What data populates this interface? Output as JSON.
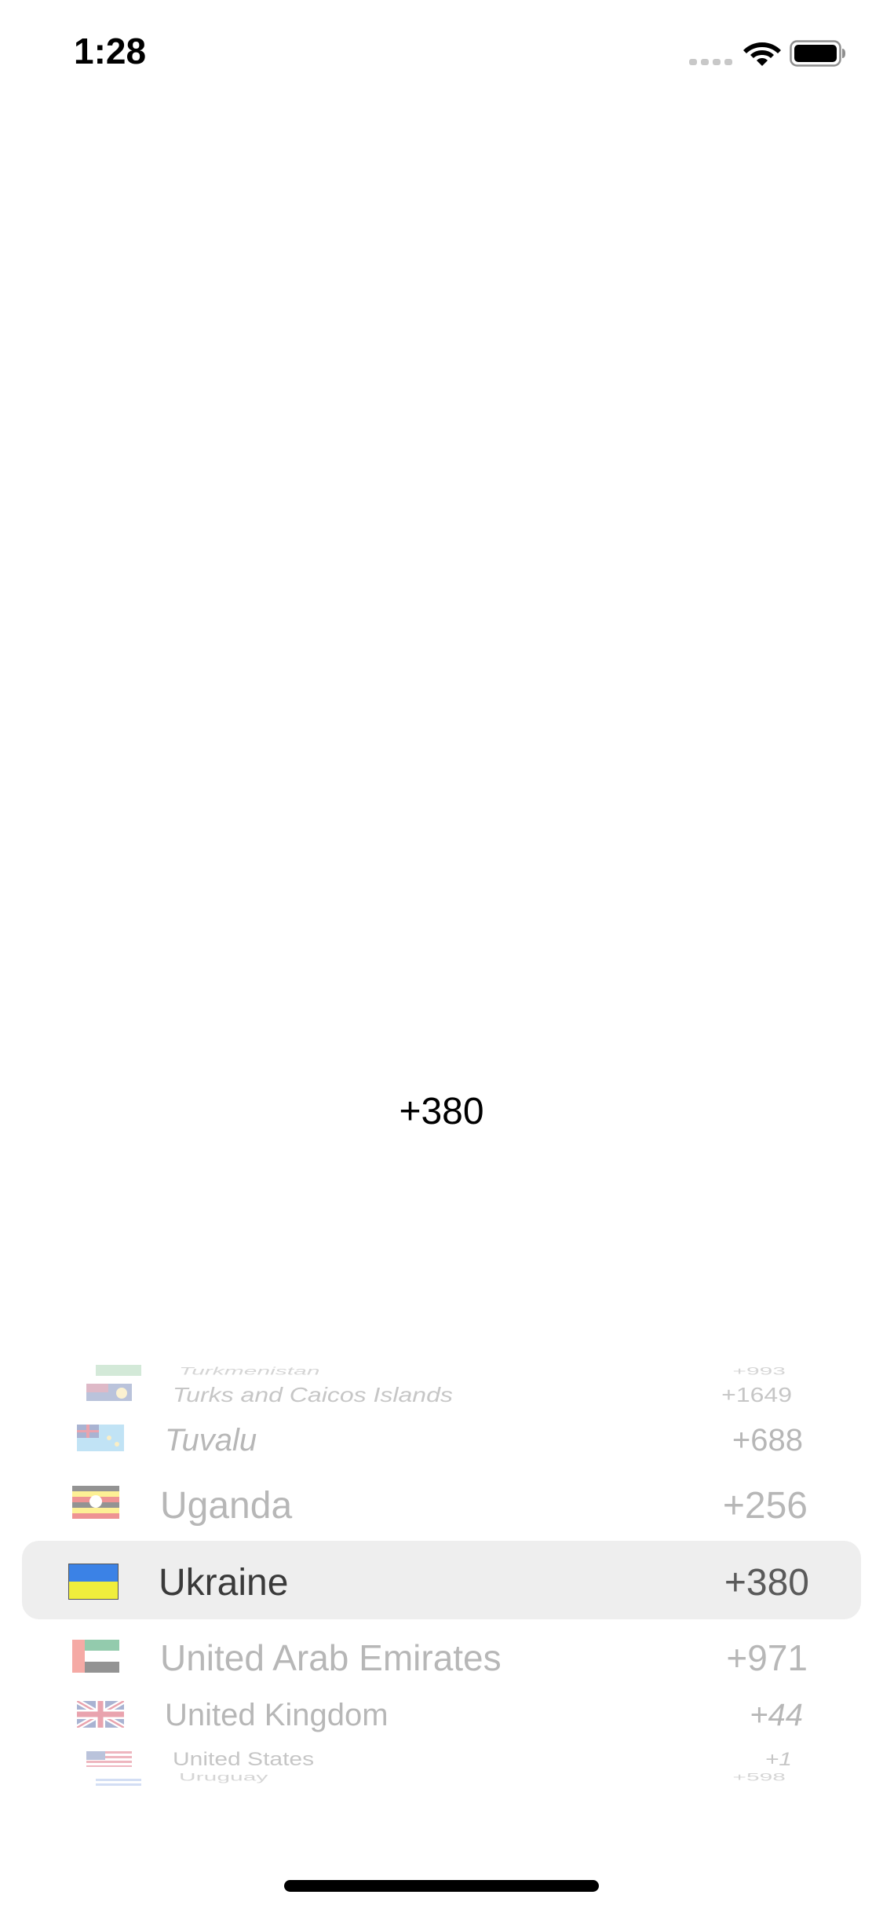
{
  "status_bar": {
    "time": "1:28",
    "icons": [
      "cellular-signal-icon",
      "wifi-icon",
      "battery-icon"
    ]
  },
  "selected": {
    "code": "+380"
  },
  "picker": {
    "selected_index": 4,
    "rows": [
      {
        "name": "Turkmenistan",
        "code": "+993",
        "flag": "turkmenistan-flag"
      },
      {
        "name": "Turks and Caicos Islands",
        "code": "+1649",
        "flag": "turks-and-caicos-flag"
      },
      {
        "name": "Tuvalu",
        "code": "+688",
        "flag": "tuvalu-flag"
      },
      {
        "name": "Uganda",
        "code": "+256",
        "flag": "uganda-flag"
      },
      {
        "name": "Ukraine",
        "code": "+380",
        "flag": "ukraine-flag"
      },
      {
        "name": "United Arab Emirates",
        "code": "+971",
        "flag": "uae-flag"
      },
      {
        "name": "United Kingdom",
        "code": "+44",
        "flag": "uk-flag"
      },
      {
        "name": "United States",
        "code": "+1",
        "flag": "usa-flag"
      },
      {
        "name": "Uruguay",
        "code": "+598",
        "flag": "uruguay-flag"
      }
    ]
  },
  "colors": {
    "highlight": "#eeeeee",
    "ukraine_blue": "#3b82e6",
    "ukraine_yellow": "#f0ee3c"
  }
}
